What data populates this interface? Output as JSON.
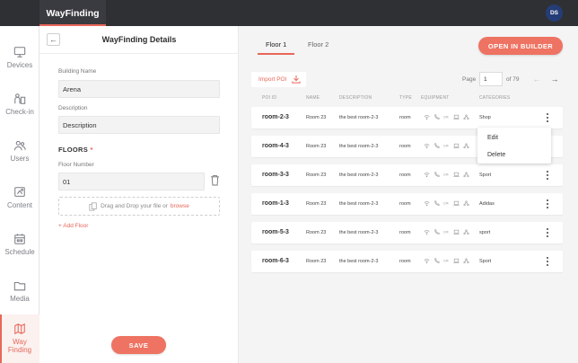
{
  "app": {
    "tab_title": "WayFinding",
    "user_initials": "DS",
    "accent_color": "#e7675a",
    "topbar_color": "#2f3034"
  },
  "nav": {
    "items": [
      {
        "label": "Devices",
        "icon": "monitor-icon"
      },
      {
        "label": "Check-in",
        "icon": "check-in-icon"
      },
      {
        "label": "Users",
        "icon": "users-icon"
      },
      {
        "label": "Content",
        "icon": "content-icon"
      },
      {
        "label": "Schedule",
        "icon": "calendar-icon"
      },
      {
        "label": "Media",
        "icon": "folder-icon"
      },
      {
        "label": "Way Finding",
        "icon": "wayfinding-icon",
        "active": true
      }
    ]
  },
  "details": {
    "title": "WayFinding Details",
    "building_name_label": "Building Name",
    "building_name_value": "Arena",
    "description_label": "Description",
    "description_value": "Description",
    "floors_heading": "FLOORS",
    "floors_required": "*",
    "floor_number_label": "Floor Number",
    "floor_number_value": "01",
    "dropzone_text": "Drag and Drop your file or",
    "dropzone_browse": "browse",
    "add_floor": "+ Add Floor",
    "save_label": "SAVE"
  },
  "main": {
    "tabs": [
      "Floor 1",
      "Floor 2"
    ],
    "active_tab": "Floor 1",
    "open_builder_label": "OPEN IN BUILDER",
    "import_label": "Import POI",
    "pager": {
      "label": "Page",
      "current": "1",
      "of_text": "of 79"
    },
    "columns": [
      "POI ID",
      "NAME",
      "DESCRIPTION",
      "TYPE",
      "EQUIPMENT",
      "CATEGORIES"
    ],
    "rows": [
      {
        "id": "room-2-3",
        "name": "Room 23",
        "description": "the best room-2-3",
        "type": "room",
        "category": "Shop"
      },
      {
        "id": "room-4-3",
        "name": "Room 23",
        "description": "the best room-2-3",
        "type": "room",
        "category": ""
      },
      {
        "id": "room-3-3",
        "name": "Room 23",
        "description": "the best room-2-3",
        "type": "room",
        "category": "Sport"
      },
      {
        "id": "room-1-3",
        "name": "Room 23",
        "description": "the best room-2-3",
        "type": "room",
        "category": "Adidas"
      },
      {
        "id": "room-5-3",
        "name": "Room 23",
        "description": "the best room-2-3",
        "type": "room",
        "category": "sport"
      },
      {
        "id": "room-6-3",
        "name": "Room 23",
        "description": "the best room-2-3",
        "type": "room",
        "category": "Sport"
      }
    ],
    "context_menu": {
      "edit": "Edit",
      "delete": "Delete"
    }
  }
}
